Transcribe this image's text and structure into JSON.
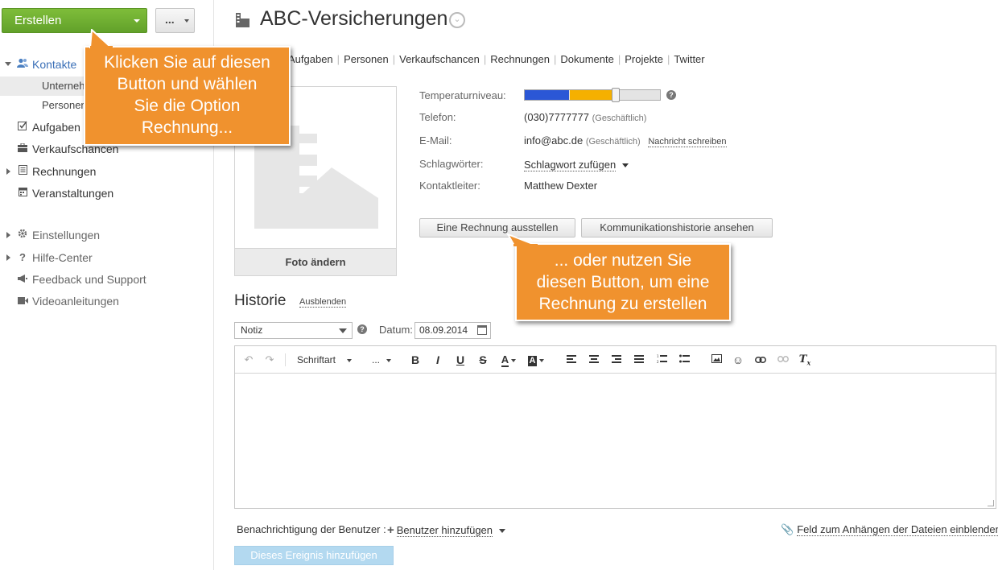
{
  "sidebar": {
    "create_label": "Erstellen",
    "more_label": "...",
    "items": [
      {
        "label": "Kontakte",
        "icon": "contacts-icon"
      },
      {
        "label": "Unternehmen"
      },
      {
        "label": "Personen"
      },
      {
        "label": "Aufgaben",
        "icon": "tasks-icon"
      },
      {
        "label": "Verkaufschancen",
        "icon": "opportunities-icon"
      },
      {
        "label": "Rechnungen",
        "icon": "invoices-icon"
      },
      {
        "label": "Veranstaltungen",
        "icon": "events-icon"
      },
      {
        "label": "Einstellungen",
        "icon": "gear-icon"
      },
      {
        "label": "Hilfe-Center",
        "icon": "help-icon"
      },
      {
        "label": "Feedback und Support",
        "icon": "megaphone-icon"
      },
      {
        "label": "Videoanleitungen",
        "icon": "video-icon"
      }
    ]
  },
  "header": {
    "title": "ABC-Versicherungen",
    "tabs": [
      "Aufgaben",
      "Personen",
      "Verkaufschancen",
      "Rechnungen",
      "Dokumente",
      "Projekte",
      "Twitter"
    ]
  },
  "photo": {
    "change_label": "Foto ändern"
  },
  "fields": {
    "temperature_label": "Temperaturniveau:",
    "temperature_level": 0.67,
    "temperature_colors": {
      "cold": "#2b57d6",
      "warm": "#f5b000"
    },
    "phone_label": "Telefon:",
    "phone_value": "(030)7777777",
    "phone_type": "(Geschäftlich)",
    "email_label": "E-Mail:",
    "email_value": "info@abc.de",
    "email_type": "(Geschäftlich)",
    "email_action": "Nachricht schreiben",
    "tags_label": "Schlagwörter:",
    "tags_action": "Schlagwort zufügen",
    "manager_label": "Kontaktleiter:",
    "manager_value": "Matthew Dexter"
  },
  "actions": {
    "invoice": "Eine Rechnung ausstellen",
    "history": "Kommunikationshistorie ansehen"
  },
  "history": {
    "title": "Historie",
    "hide": "Ausblenden",
    "type_selected": "Notiz",
    "date_label": "Datum:",
    "date_value": "08.09.2014"
  },
  "editor": {
    "font_label": "Schriftart",
    "size_label": "...",
    "bold": "B",
    "italic": "I",
    "underline": "U",
    "strike": "S"
  },
  "footer": {
    "notify_label": "Benachrichtigung der Benutzer :",
    "add_user": "Benutzer hinzufügen",
    "attach": "Feld zum Anhängen der Dateien einblenden",
    "submit": "Dieses Ereignis hinzufügen"
  },
  "callouts": {
    "first": [
      "Klicken Sie auf diesen",
      "Button und wählen",
      "Sie die Option",
      "Rechnung..."
    ],
    "second": [
      "... oder nutzen Sie",
      "diesen Button, um eine",
      "Rechnung zu erstellen"
    ]
  },
  "colors": {
    "accent_green": "#6aab2e",
    "callout_orange": "#f0922e",
    "submit_blue": "#b3d9f0"
  }
}
